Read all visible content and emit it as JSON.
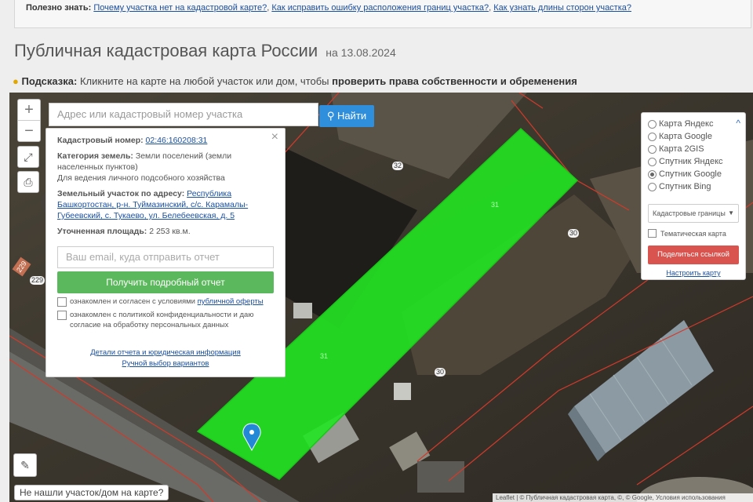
{
  "tip_bar": {
    "label": "Полезно знать:",
    "links": [
      "Почему участка нет на кадастровой карте?",
      "Как исправить ошибку расположения границ участка?",
      "Как узнать длины сторон участка?"
    ],
    "separator": ","
  },
  "header": {
    "title": "Публичная кадастровая карта России",
    "date": "на 13.08.2024"
  },
  "hint": {
    "label": "Подсказка:",
    "text": "Кликните на карте на любой участок или дом, чтобы",
    "bold_text": "проверить права собственности и обременения"
  },
  "map_controls": {
    "zoom_in": "+",
    "zoom_out": "−",
    "search_placeholder": "Адрес или кадастровый номер участка",
    "find_button": "Найти"
  },
  "popup": {
    "cadastral_label": "Кадастровый номер:",
    "cadastral_number": "02:46:160208:31",
    "category_label": "Категория земель:",
    "category_value": "Земли поселений (земли населенных пунктов)",
    "usage": "Для ведения личного подсобного хозяйства",
    "address_label": "Земельный участок по адресу:",
    "address_value": "Республика Башкортостан, р-н. Туймазинский, с/с. Карамалы-Губеевский, с. Тукаево, ул. Белебеевская, д. 5",
    "area_label": "Уточненная площадь:",
    "area_value": "2 253 кв.м.",
    "email_placeholder": "Ваш email, куда отправить отчет",
    "report_button": "Получить подробный отчет",
    "checkbox1_text": "ознакомлен и согласен с условиями",
    "checkbox1_link": "публичной оферты",
    "checkbox2_text": "ознакомлен с политикой конфиденциальности и даю согласие на обработку персональных данных",
    "link_details": "Детали отчета и юридическая информация",
    "link_manual": "Ручной выбор вариантов"
  },
  "layers": {
    "options": [
      {
        "label": "Карта Яндекс",
        "selected": false
      },
      {
        "label": "Карта Google",
        "selected": false
      },
      {
        "label": "Карта 2GIS",
        "selected": false
      },
      {
        "label": "Спутник Яндекс",
        "selected": false
      },
      {
        "label": "Спутник Google",
        "selected": true
      },
      {
        "label": "Спутник Bing",
        "selected": false
      }
    ],
    "boundaries_select": "Кадастровые границы",
    "thematic": "Тематическая карта",
    "share_button": "Поделиться ссылкой",
    "settings_link": "Настроить карту"
  },
  "map_labels": {
    "house_32": "32",
    "house_30_top": "30",
    "house_30_bottom": "30",
    "parcel_31_top": "31",
    "parcel_31_bottom": "31",
    "house_229": "229",
    "road_badge": "229"
  },
  "footer": {
    "not_found": "Не нашли участок/дом на карте?",
    "attribution": "Leaflet | © Публичная кадастровая карта, ©, © Google, Условия использования"
  },
  "colors": {
    "parcel_fill": "#22e622",
    "find_button": "#2f8fdd",
    "report_button": "#5cb85c",
    "share_button": "#d9534f",
    "link": "#1a4fa0"
  }
}
